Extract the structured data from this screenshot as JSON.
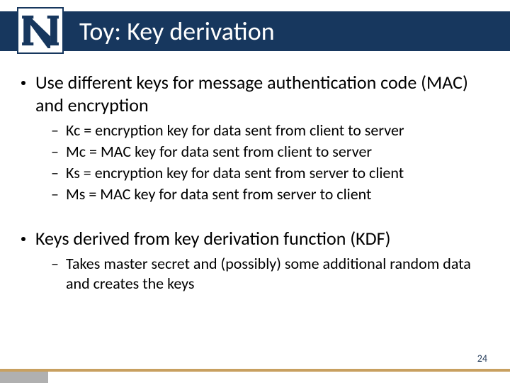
{
  "header": {
    "title": "Toy: Key derivation",
    "logo": "nevada-n-logo"
  },
  "bullets": [
    {
      "text": "Use different keys for message authentication code (MAC) and encryption",
      "sub": [
        "Kc = encryption key for data sent from client to server",
        "Mc = MAC key for data sent from client to server",
        "Ks = encryption key for data sent from server to client",
        "Ms = MAC key for data sent from server to client"
      ]
    },
    {
      "text": "Keys derived from key derivation function (KDF)",
      "sub": [
        "Takes master secret and (possibly) some additional random data and creates the keys"
      ]
    }
  ],
  "footer": {
    "page_number": "24"
  },
  "colors": {
    "brand_navy": "#17375e",
    "accent_tan": "#c8a060",
    "accent_gray": "#b0b0b0"
  }
}
